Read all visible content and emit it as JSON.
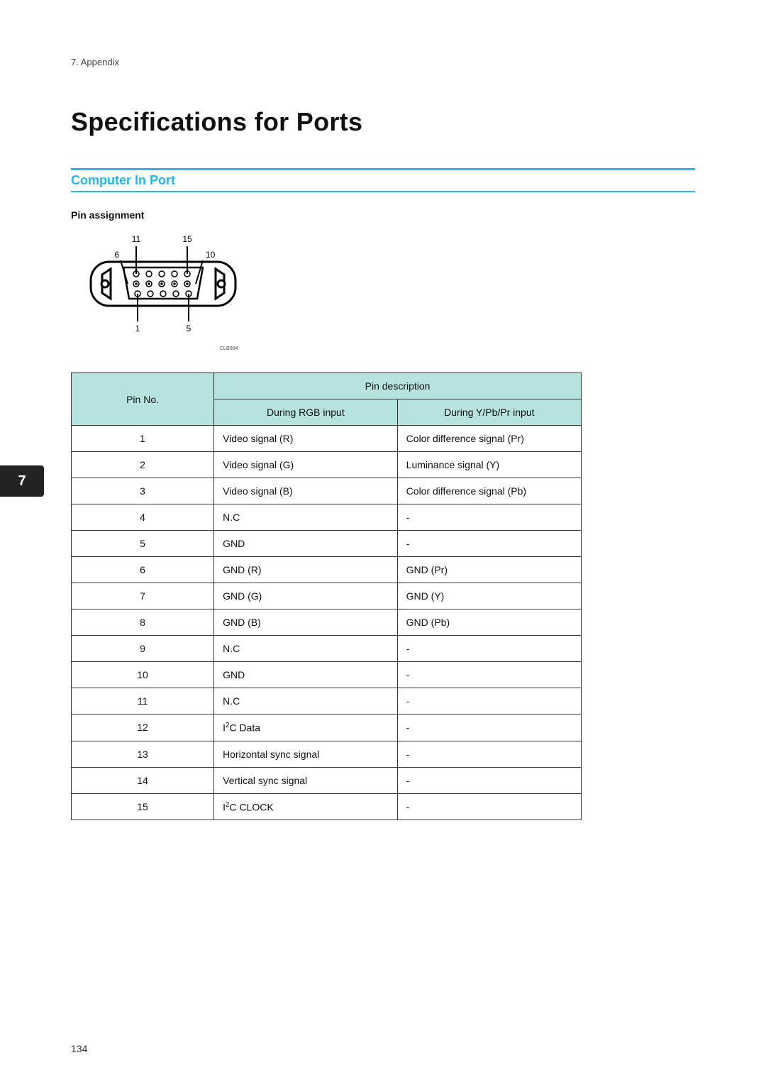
{
  "breadcrumb": "7. Appendix",
  "page_title": "Specifications for Ports",
  "section_title": "Computer In Port",
  "subheading": "Pin assignment",
  "diagram_code": "CLB064",
  "diagram_pin_labels": {
    "tl": "11",
    "tr": "15",
    "ml": "6",
    "mr": "10",
    "bl": "1",
    "br": "5"
  },
  "side_tab": "7",
  "page_number": "134",
  "accent_color": "#28b7e0",
  "table": {
    "header": {
      "pin_no": "Pin No.",
      "desc_group": "Pin description",
      "col_rgb": "During RGB input",
      "col_ypbpr": "During Y/Pb/Pr input"
    },
    "rows": [
      {
        "no": "1",
        "rgb": "Video signal (R)",
        "y": "Color difference signal (Pr)"
      },
      {
        "no": "2",
        "rgb": "Video signal (G)",
        "y": "Luminance signal (Y)"
      },
      {
        "no": "3",
        "rgb": "Video signal (B)",
        "y": "Color difference signal (Pb)"
      },
      {
        "no": "4",
        "rgb": "N.C",
        "y": "-"
      },
      {
        "no": "5",
        "rgb": "GND",
        "y": "-"
      },
      {
        "no": "6",
        "rgb": "GND (R)",
        "y": "GND (Pr)"
      },
      {
        "no": "7",
        "rgb": "GND (G)",
        "y": "GND (Y)"
      },
      {
        "no": "8",
        "rgb": "GND (B)",
        "y": "GND (Pb)"
      },
      {
        "no": "9",
        "rgb": "N.C",
        "y": "-"
      },
      {
        "no": "10",
        "rgb": "GND",
        "y": "-"
      },
      {
        "no": "11",
        "rgb": "N.C",
        "y": "-"
      },
      {
        "no": "12",
        "rgb": "I2C Data",
        "y": "-",
        "i2c": true
      },
      {
        "no": "13",
        "rgb": "Horizontal sync signal",
        "y": "-"
      },
      {
        "no": "14",
        "rgb": "Vertical sync signal",
        "y": "-"
      },
      {
        "no": "15",
        "rgb": "I2C CLOCK",
        "y": "-",
        "i2c": true
      }
    ]
  }
}
